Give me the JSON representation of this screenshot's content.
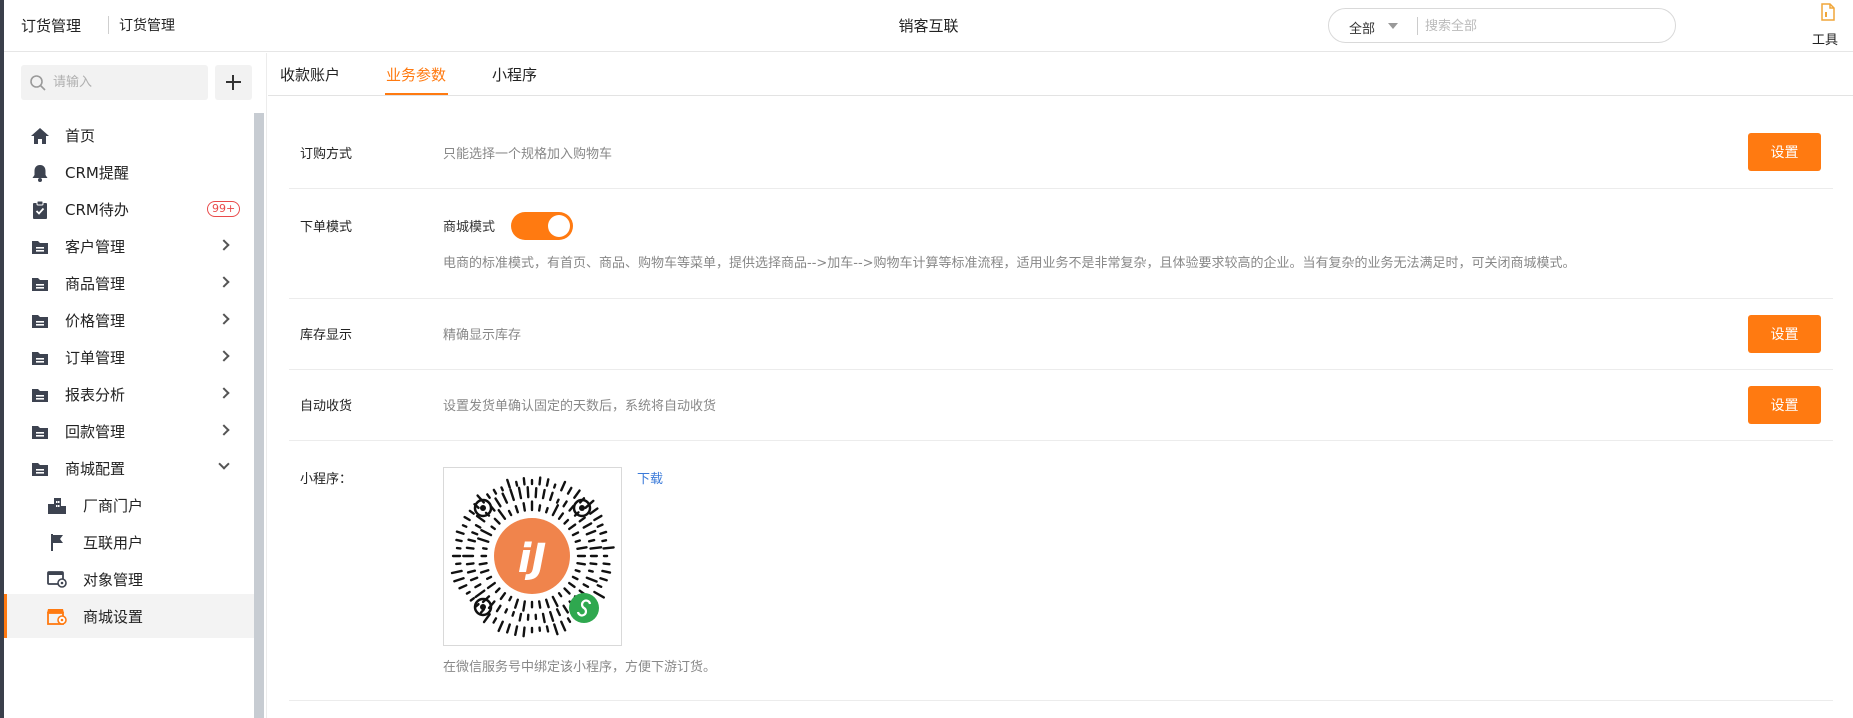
{
  "header": {
    "app_title": "订货管理",
    "breadcrumb": "订货管理",
    "center_title": "销客互联",
    "search_scope": "全部",
    "search_placeholder": "搜索全部",
    "tools_label": "工具"
  },
  "sidebar": {
    "search_placeholder": "请输入",
    "todo_badge": "99+",
    "items": [
      {
        "label": "首页",
        "icon": "home-icon"
      },
      {
        "label": "CRM提醒",
        "icon": "bell-icon"
      },
      {
        "label": "CRM待办",
        "icon": "clipboard-check-icon"
      },
      {
        "label": "客户管理",
        "icon": "folder-icon"
      },
      {
        "label": "商品管理",
        "icon": "folder-icon"
      },
      {
        "label": "价格管理",
        "icon": "folder-icon"
      },
      {
        "label": "订单管理",
        "icon": "folder-icon"
      },
      {
        "label": "报表分析",
        "icon": "folder-icon"
      },
      {
        "label": "回款管理",
        "icon": "folder-icon"
      },
      {
        "label": "商城配置",
        "icon": "folder-icon"
      }
    ],
    "sub_items": [
      {
        "label": "厂商门户",
        "icon": "building-icon"
      },
      {
        "label": "互联用户",
        "icon": "flag-icon"
      },
      {
        "label": "对象管理",
        "icon": "object-settings-icon"
      },
      {
        "label": "商城设置",
        "icon": "store-settings-icon"
      }
    ]
  },
  "tabs": [
    {
      "label": "收款账户"
    },
    {
      "label": "业务参数"
    },
    {
      "label": "小程序"
    }
  ],
  "settings": {
    "order_method": {
      "label": "订购方式",
      "desc": "只能选择一个规格加入购物车",
      "button": "设置"
    },
    "order_mode": {
      "label": "下单模式",
      "toggle_label": "商城模式",
      "toggle_on": true,
      "desc": "电商的标准模式，有首页、商品、购物车等菜单，提供选择商品-->加车-->购物车计算等标准流程，适用业务不是非常复杂，且体验要求较高的企业。当有复杂的业务无法满足时，可关闭商城模式。"
    },
    "stock_display": {
      "label": "库存显示",
      "desc": "精确显示库存",
      "button": "设置"
    },
    "auto_receive": {
      "label": "自动收货",
      "desc": "设置发货单确认固定的天数后，系统将自动收货",
      "button": "设置"
    },
    "mini_program": {
      "label": "小程序：",
      "download": "下载",
      "qr_logo_text": "iJ",
      "note": "在微信服务号中绑定该小程序，方便下游订货。"
    }
  },
  "colors": {
    "accent": "#ff7a11",
    "link": "#3a7ad9",
    "sidebar_icon": "#3d4350"
  }
}
